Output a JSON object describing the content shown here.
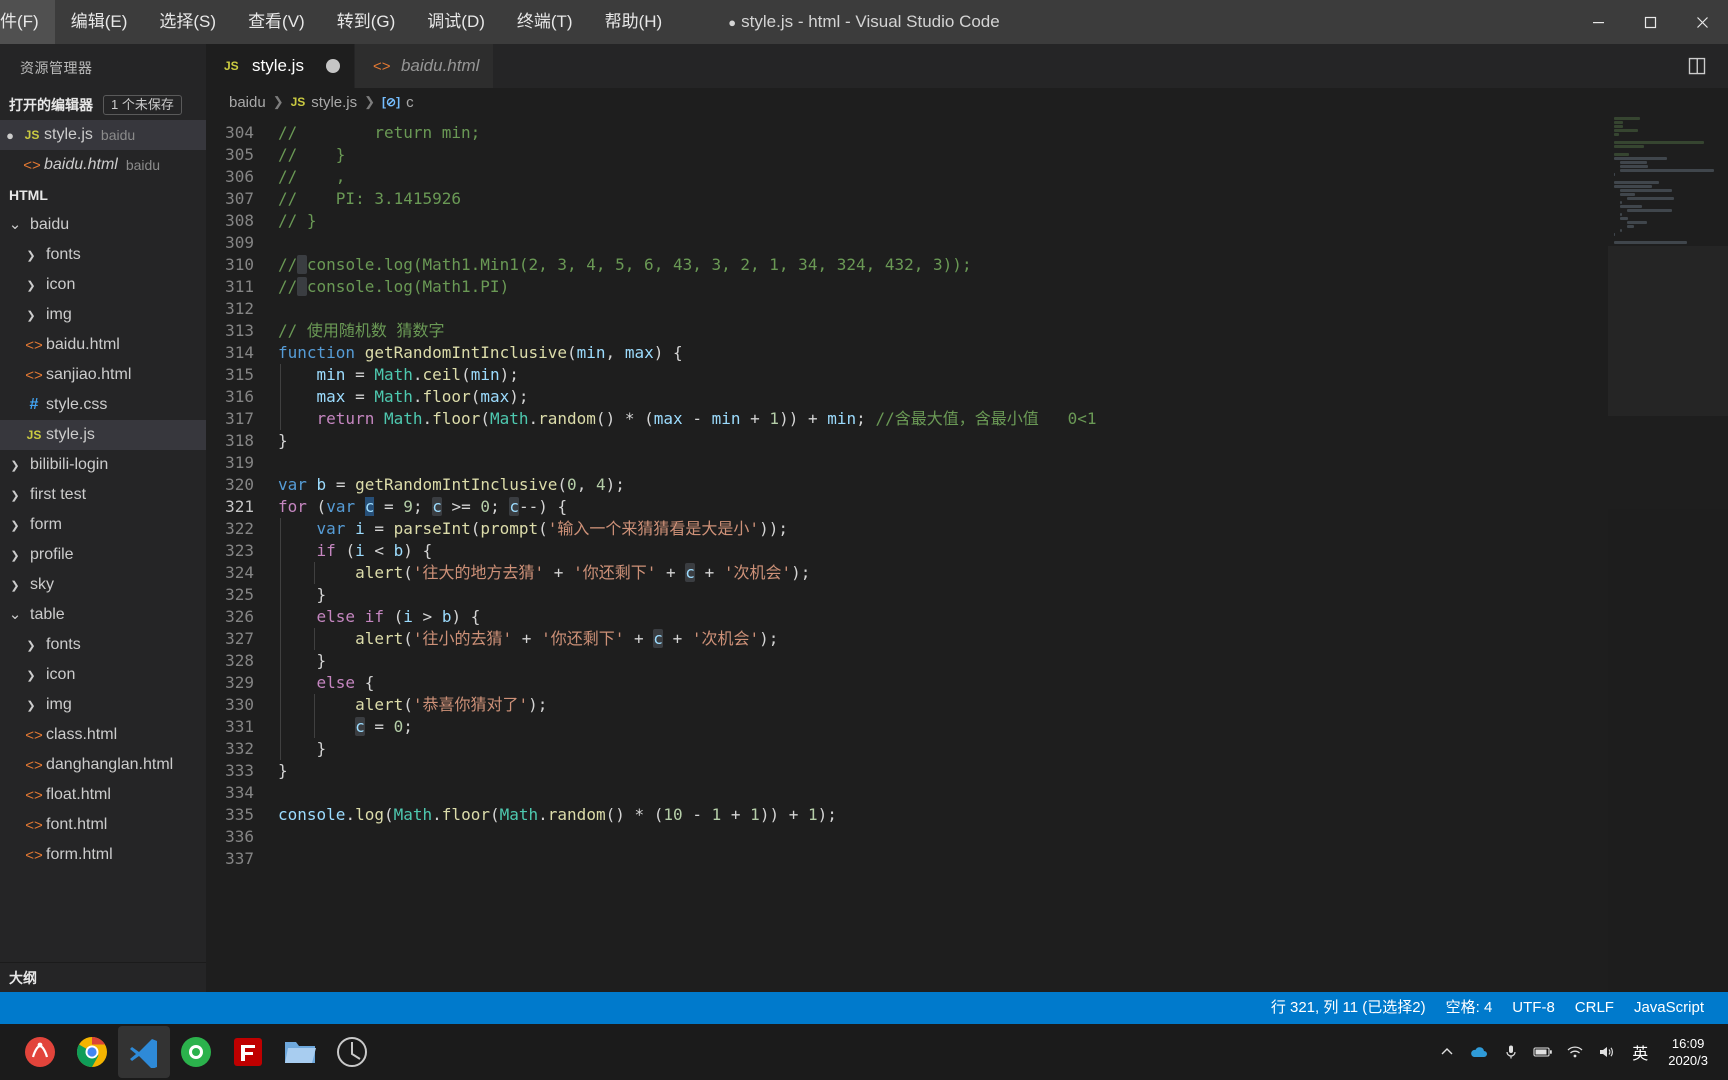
{
  "titlebar": {
    "menus": [
      "件(F)",
      "编辑(E)",
      "选择(S)",
      "查看(V)",
      "转到(G)",
      "调试(D)",
      "终端(T)",
      "帮助(H)"
    ],
    "window_title": "style.js - html - Visual Studio Code",
    "dirty_marker": "●",
    "buttons": {
      "minimize": "minimize-icon",
      "maximize": "maximize-icon",
      "close": "close-icon"
    }
  },
  "sidebar": {
    "title": "资源管理器",
    "open_editors": {
      "label": "打开的编辑器",
      "badge": "1 个未保存"
    },
    "open_editor_items": [
      {
        "name": "style.js",
        "folder": "baidu",
        "icon": "js",
        "dirty": true,
        "italic": false,
        "selected": true
      },
      {
        "name": "baidu.html",
        "folder": "baidu",
        "icon": "html",
        "dirty": false,
        "italic": true,
        "selected": false
      }
    ],
    "workspace_label": "HTML",
    "tree": [
      {
        "label": "baidu",
        "indent": 0,
        "kind": "folder-open",
        "icon": ""
      },
      {
        "label": "fonts",
        "indent": 1,
        "kind": "folder",
        "icon": ""
      },
      {
        "label": "icon",
        "indent": 1,
        "kind": "folder",
        "icon": ""
      },
      {
        "label": "img",
        "indent": 1,
        "kind": "folder",
        "icon": ""
      },
      {
        "label": "baidu.html",
        "indent": 1,
        "kind": "file",
        "icon": "html"
      },
      {
        "label": "sanjiao.html",
        "indent": 1,
        "kind": "file",
        "icon": "html"
      },
      {
        "label": "style.css",
        "indent": 1,
        "kind": "file",
        "icon": "css"
      },
      {
        "label": "style.js",
        "indent": 1,
        "kind": "file",
        "icon": "js",
        "selected": true
      },
      {
        "label": "bilibili-login",
        "indent": 0,
        "kind": "folder",
        "icon": ""
      },
      {
        "label": "first test",
        "indent": 0,
        "kind": "folder",
        "icon": ""
      },
      {
        "label": "form",
        "indent": 0,
        "kind": "folder",
        "icon": ""
      },
      {
        "label": "profile",
        "indent": 0,
        "kind": "folder",
        "icon": ""
      },
      {
        "label": "sky",
        "indent": 0,
        "kind": "folder",
        "icon": ""
      },
      {
        "label": "table",
        "indent": 0,
        "kind": "folder-open",
        "icon": ""
      },
      {
        "label": "fonts",
        "indent": 1,
        "kind": "folder",
        "icon": ""
      },
      {
        "label": "icon",
        "indent": 1,
        "kind": "folder",
        "icon": ""
      },
      {
        "label": "img",
        "indent": 1,
        "kind": "folder",
        "icon": ""
      },
      {
        "label": "class.html",
        "indent": 1,
        "kind": "file",
        "icon": "html"
      },
      {
        "label": "danghanglan.html",
        "indent": 1,
        "kind": "file",
        "icon": "html"
      },
      {
        "label": "float.html",
        "indent": 1,
        "kind": "file",
        "icon": "html"
      },
      {
        "label": "font.html",
        "indent": 1,
        "kind": "file",
        "icon": "html"
      },
      {
        "label": "form.html",
        "indent": 1,
        "kind": "file",
        "icon": "html"
      }
    ],
    "outline_label": "大纲"
  },
  "tabs": [
    {
      "label": "style.js",
      "icon": "js",
      "active": true,
      "italic": false,
      "dirty": true
    },
    {
      "label": "baidu.html",
      "icon": "html",
      "active": false,
      "italic": true,
      "dirty": false
    }
  ],
  "tab_actions": {
    "split_editor": "split-editor-icon"
  },
  "breadcrumbs": [
    {
      "label": "baidu",
      "icon": ""
    },
    {
      "label": "style.js",
      "icon": "js"
    },
    {
      "label": "c",
      "icon": "symbol-variable"
    }
  ],
  "editor": {
    "first_line": 304,
    "lines": [
      {
        "n": 304,
        "text": "//        return min;"
      },
      {
        "n": 305,
        "text": "//    }"
      },
      {
        "n": 306,
        "text": "//    ,"
      },
      {
        "n": 307,
        "text": "//    PI: 3.1415926"
      },
      {
        "n": 308,
        "text": "// }"
      },
      {
        "n": 309,
        "text": ""
      },
      {
        "n": 310,
        "text": "// console.log(Math1.Min1(2, 3, 4, 5, 6, 43, 3, 2, 1, 34, 324, 432, 3));"
      },
      {
        "n": 311,
        "text": "// console.log(Math1.PI)"
      },
      {
        "n": 312,
        "text": ""
      },
      {
        "n": 313,
        "text": "// 使用随机数 猜数字"
      },
      {
        "n": 314,
        "text": "function getRandomIntInclusive(min, max) {"
      },
      {
        "n": 315,
        "text": "    min = Math.ceil(min);"
      },
      {
        "n": 316,
        "text": "    max = Math.floor(max);"
      },
      {
        "n": 317,
        "text": "    return Math.floor(Math.random() * (max - min + 1)) + min; //含最大值，含最小值   0<1"
      },
      {
        "n": 318,
        "text": "}"
      },
      {
        "n": 319,
        "text": ""
      },
      {
        "n": 320,
        "text": "var b = getRandomIntInclusive(0, 4);"
      },
      {
        "n": 321,
        "text": "for (var c = 9; c >= 0; c--) {"
      },
      {
        "n": 322,
        "text": "    var i = parseInt(prompt('输入一个来猜猜看是大是小'));"
      },
      {
        "n": 323,
        "text": "    if (i < b) {"
      },
      {
        "n": 324,
        "text": "        alert('往大的地方去猜' + '你还剩下' + c + '次机会');"
      },
      {
        "n": 325,
        "text": "    }"
      },
      {
        "n": 326,
        "text": "    else if (i > b) {"
      },
      {
        "n": 327,
        "text": "        alert('往小的去猜' + '你还剩下' + c + '次机会');"
      },
      {
        "n": 328,
        "text": "    }"
      },
      {
        "n": 329,
        "text": "    else {"
      },
      {
        "n": 330,
        "text": "        alert('恭喜你猜对了');"
      },
      {
        "n": 331,
        "text": "        c = 0;"
      },
      {
        "n": 332,
        "text": "    }"
      },
      {
        "n": 333,
        "text": "}"
      },
      {
        "n": 334,
        "text": ""
      },
      {
        "n": 335,
        "text": "console.log(Math.floor(Math.random() * (10 - 1 + 1)) + 1);"
      },
      {
        "n": 336,
        "text": ""
      },
      {
        "n": 337,
        "text": ""
      }
    ]
  },
  "statusbar": {
    "cursor": "行 321, 列 11 (已选择2)",
    "indent": "空格: 4",
    "encoding": "UTF-8",
    "eol": "CRLF",
    "language": "JavaScript"
  },
  "taskbar": {
    "apps": [
      "start-icon",
      "chrome-icon",
      "vscode-icon",
      "browser-icon",
      "filezilla-icon",
      "explorer-icon",
      "app-icon"
    ],
    "tray": [
      "chevron-up-icon",
      "onedrive-icon",
      "microphone-icon",
      "battery-icon",
      "network-icon",
      "volume-icon"
    ],
    "ime_label": "英",
    "clock_time": "16:09",
    "clock_date": "2020/3"
  },
  "colors": {
    "accent": "#007acc",
    "titlebar_bg": "#3c3c3c",
    "sidebar_bg": "#252526",
    "editor_bg": "#1e1e1e",
    "comment": "#6a9955",
    "string": "#ce9178",
    "keyword": "#569cd6",
    "control": "#c586c0",
    "function": "#dcdcaa",
    "variable": "#9cdcfe",
    "number": "#b5cea8",
    "class": "#4ec9b0",
    "selection": "#264f78",
    "word_highlight": "#3a3d41",
    "js_icon": "#cbcb41",
    "html_icon": "#e37933",
    "css_icon": "#42a5f5"
  }
}
